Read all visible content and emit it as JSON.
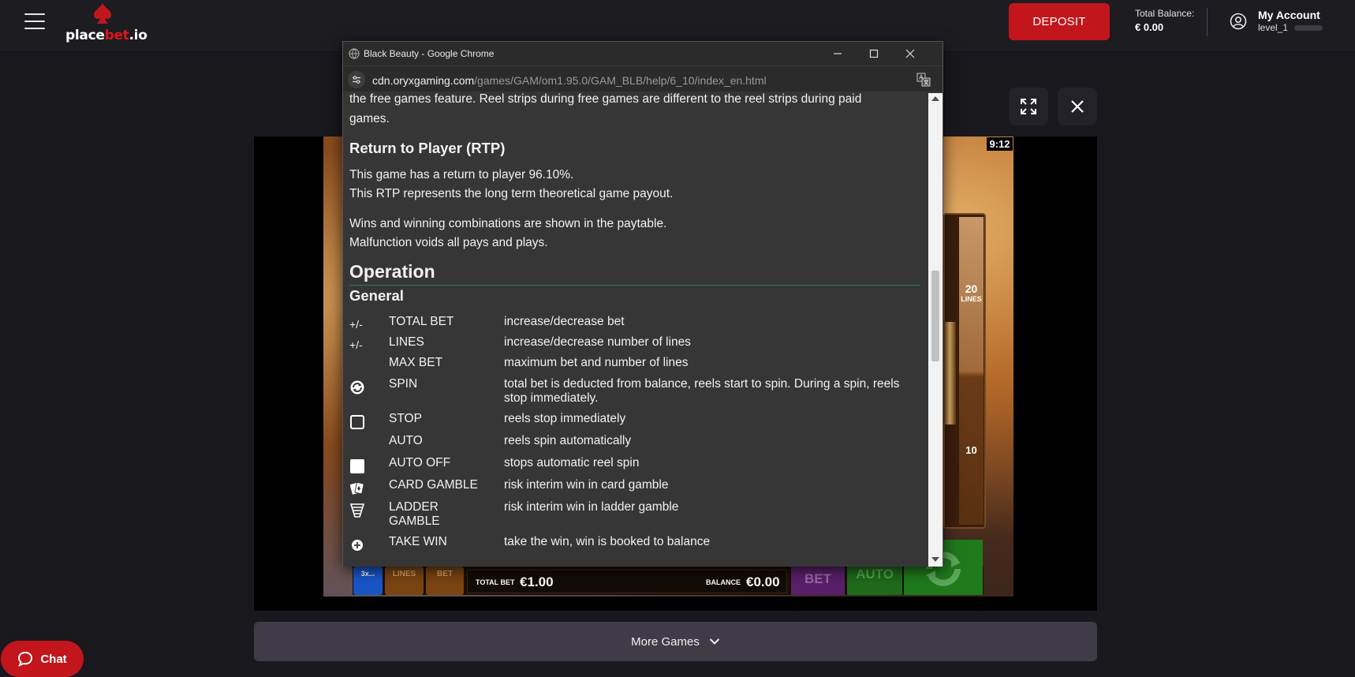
{
  "header": {
    "logo_parts": [
      "place",
      "bet",
      ".io"
    ],
    "deposit_label": "DEPOSIT",
    "balance_label": "Total Balance:",
    "balance_value": "€ 0.00",
    "account_name": "My Account",
    "account_level": "level_1"
  },
  "game": {
    "timer": "9:12",
    "lines_count": "20",
    "lines_label": "LINES",
    "lines_low": "10",
    "bottom_bar": {
      "turbo_label": "3x...",
      "lines_label": "LINES",
      "bet_label": "BET",
      "total_bet_label": "TOTAL BET",
      "total_bet_value": "€1.00",
      "balance_label": "BALANCE",
      "balance_value": "€0.00",
      "bet_button": "BET",
      "auto_button": "AUTO"
    }
  },
  "popup": {
    "window_title": "Black Beauty - Google Chrome",
    "url_host": "cdn.oryxgaming.com",
    "url_path": "/games/GAM/om1.95.0/GAM_BLB/help/6_10/index_en.html",
    "content": {
      "intro_line1": "the free games feature. Reel strips during free games are different to the reel strips during paid",
      "intro_line2": "games.",
      "rtp_heading": "Return to Player (RTP)",
      "rtp_line1": "This game has a return to player 96.10%.",
      "rtp_line2": "This RTP represents the long term theoretical game payout.",
      "wins_line1": "Wins and winning combinations are shown in the paytable.",
      "wins_line2": "Malfunction voids all pays and plays.",
      "operation_heading": "Operation",
      "general_heading": "General",
      "operations": [
        {
          "prefix": "+/-",
          "key": "TOTAL BET",
          "desc": "increase/decrease bet"
        },
        {
          "prefix": "+/-",
          "key": "LINES",
          "desc": "increase/decrease number of lines"
        },
        {
          "prefix": "",
          "key": "MAX BET",
          "desc": "maximum bet and number of lines"
        },
        {
          "prefix": "",
          "key": "SPIN",
          "desc": "total bet is deducted from balance, reels start to spin. During a spin, reels stop immediately.",
          "icon": "spin-icon"
        },
        {
          "prefix": "",
          "key": "STOP",
          "desc": "reels stop immediately",
          "icon": "stop-square-icon"
        },
        {
          "prefix": "",
          "key": "AUTO",
          "desc": "reels spin automatically"
        },
        {
          "prefix": "",
          "key": "AUTO OFF",
          "desc": "stops automatic reel spin",
          "icon": "auto-off-square-icon"
        },
        {
          "prefix": "",
          "key": "CARD GAMBLE",
          "desc": "risk interim win in card gamble",
          "icon": "card-gamble-icon"
        },
        {
          "prefix": "",
          "key": "LADDER GAMBLE",
          "desc": "risk interim win in ladder gamble",
          "icon": "ladder-gamble-icon"
        },
        {
          "prefix": "",
          "key": "TAKE WIN",
          "desc": "take the win, win is booked to balance",
          "icon": "take-win-icon"
        }
      ]
    }
  },
  "footer": {
    "more_games_label": "More Games",
    "chat_label": "Chat"
  },
  "colors": {
    "brand_red": "#c2161c",
    "page_bg": "#19181d",
    "popup_bg": "#363636",
    "heading_rule": "#2a7a4a"
  }
}
